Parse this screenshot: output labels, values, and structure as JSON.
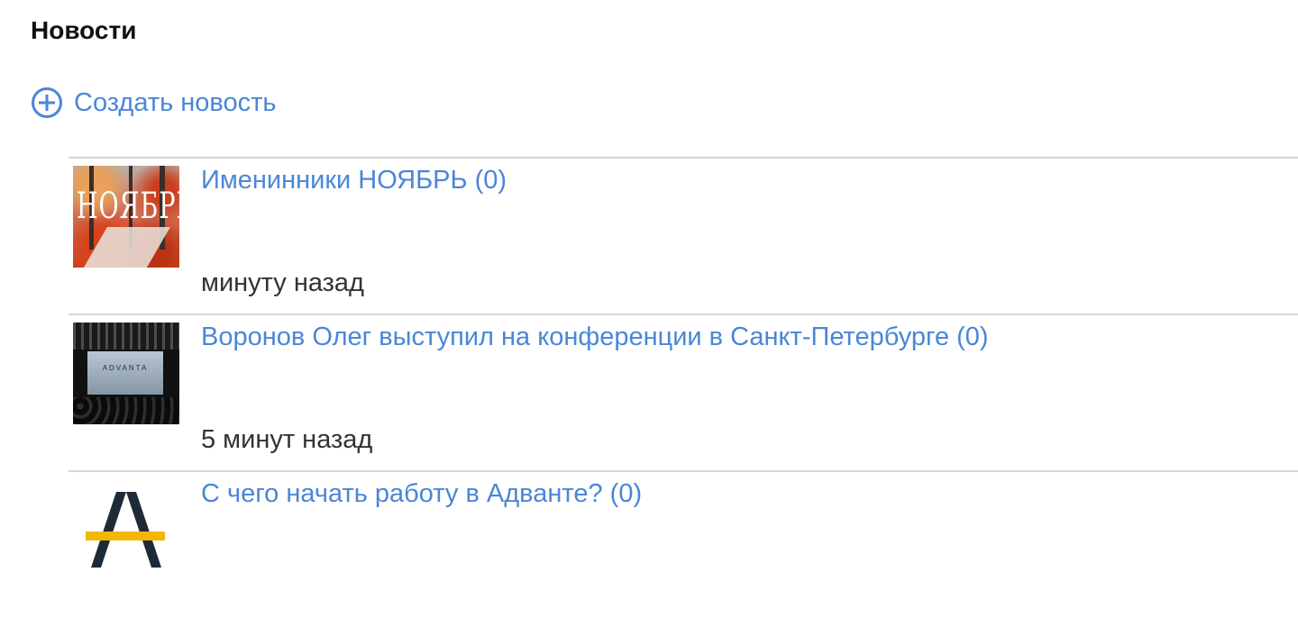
{
  "page": {
    "title": "Новости",
    "create_label": "Создать новость"
  },
  "news": [
    {
      "title": "Именинники НОЯБРЬ (0)",
      "time": "минуту назад",
      "image_text": "НОЯБРЬ"
    },
    {
      "title": "Воронов Олег выступил на конференции в Санкт-Петербурге (0)",
      "time": "5 минут назад",
      "image_text": "ADVANTA"
    },
    {
      "title": "С чего начать работу в Адванте? (0)",
      "time": ""
    }
  ],
  "icons": {
    "create": "plus-circle-icon"
  },
  "colors": {
    "link": "#4a86d8",
    "logo_dark": "#1f2a37",
    "logo_accent": "#f2b705"
  }
}
